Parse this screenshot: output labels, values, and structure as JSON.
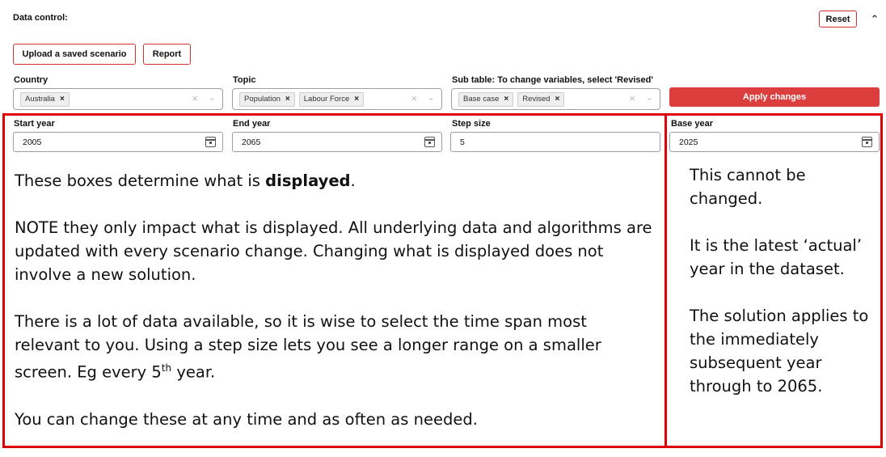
{
  "header": {
    "title": "Data control:",
    "reset_label": "Reset",
    "collapse_glyph": "⌃"
  },
  "actions": {
    "upload_label": "Upload a saved scenario",
    "report_label": "Report",
    "apply_label": "Apply changes"
  },
  "filters": {
    "country": {
      "label": "Country",
      "chips": [
        "Australia"
      ]
    },
    "topic": {
      "label": "Topic",
      "chips": [
        "Population",
        "Labour Force"
      ]
    },
    "subtable": {
      "label": "Sub table: To change variables, select 'Revised'",
      "chips": [
        "Base case",
        "Revised"
      ]
    },
    "clear_glyph": "×",
    "arrow_glyph": "⌄",
    "chip_remove_glyph": "×"
  },
  "years": {
    "start": {
      "label": "Start year",
      "value": "2005"
    },
    "end": {
      "label": "End year",
      "value": "2065"
    },
    "step": {
      "label": "Step size",
      "value": "5"
    },
    "base": {
      "label": "Base year",
      "value": "2025"
    }
  },
  "annotation_left": {
    "line1_pre": "These boxes determine what is ",
    "line1_bold": "displayed",
    "line1_post": ".",
    "para2": "NOTE they only impact what is displayed.  All underlying data and algorithms are updated with every scenario change.  Changing what is displayed does not involve a new solution.",
    "para3_pre": "There is a lot of data available, so it is wise to select the time span most relevant to you. Using a step size lets you see a longer range on a smaller screen. Eg every 5",
    "para3_sup": "th",
    "para3_post": " year.",
    "para4": "You can change these at any time and as often as needed."
  },
  "annotation_right": {
    "para1": "This cannot be changed.",
    "para2": "It is the latest ‘actual’ year in the dataset.",
    "para3": "The solution applies to the immediately subsequent year through to 2065."
  },
  "colors": {
    "accent_red": "#dc3d3d",
    "frame_red": "#e00000",
    "button_border": "#d32f2f"
  },
  "icons": [
    "calendar-icon",
    "chevron-up-icon",
    "chevron-down-icon",
    "clear-icon",
    "chip-remove-icon"
  ]
}
